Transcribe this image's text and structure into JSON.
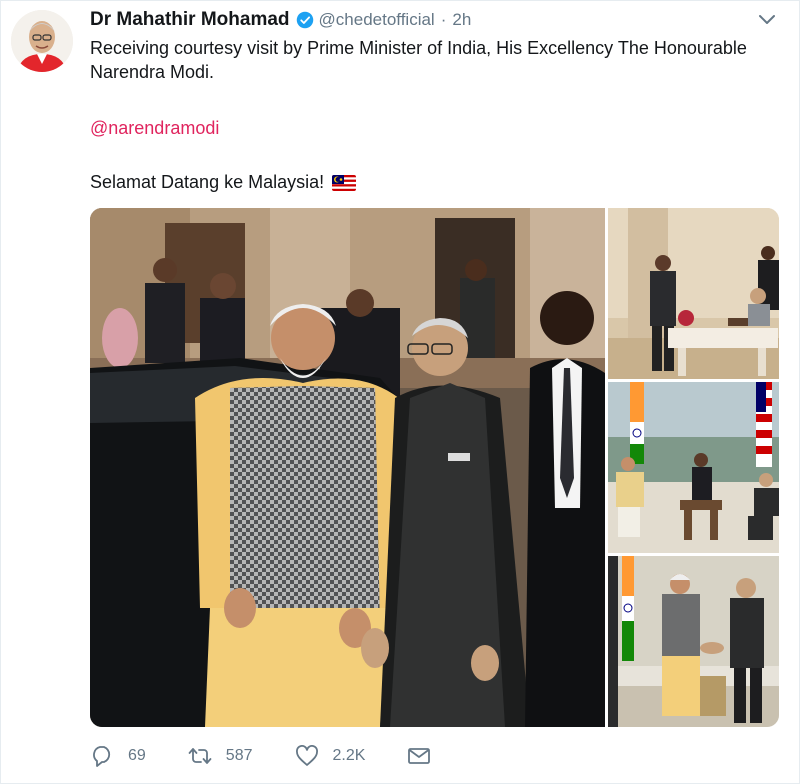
{
  "tweet": {
    "author_name": "Dr Mahathir Mohamad",
    "handle": "@chedetofficial",
    "separator": "·",
    "time": "2h",
    "text": "Receiving courtesy visit by Prime Minister of India, His Excellency The Honourable Narendra Modi.",
    "mention": "@narendramodi",
    "greeting": "Selamat Datang ke Malaysia!",
    "flag_emoji": "malaysia-flag"
  },
  "actions": {
    "reply_count": "69",
    "retweet_count": "587",
    "like_count": "2.2K"
  },
  "colors": {
    "text": "#14171a",
    "muted": "#657786",
    "mention": "#e0245e",
    "verified": "#1da1f2"
  }
}
